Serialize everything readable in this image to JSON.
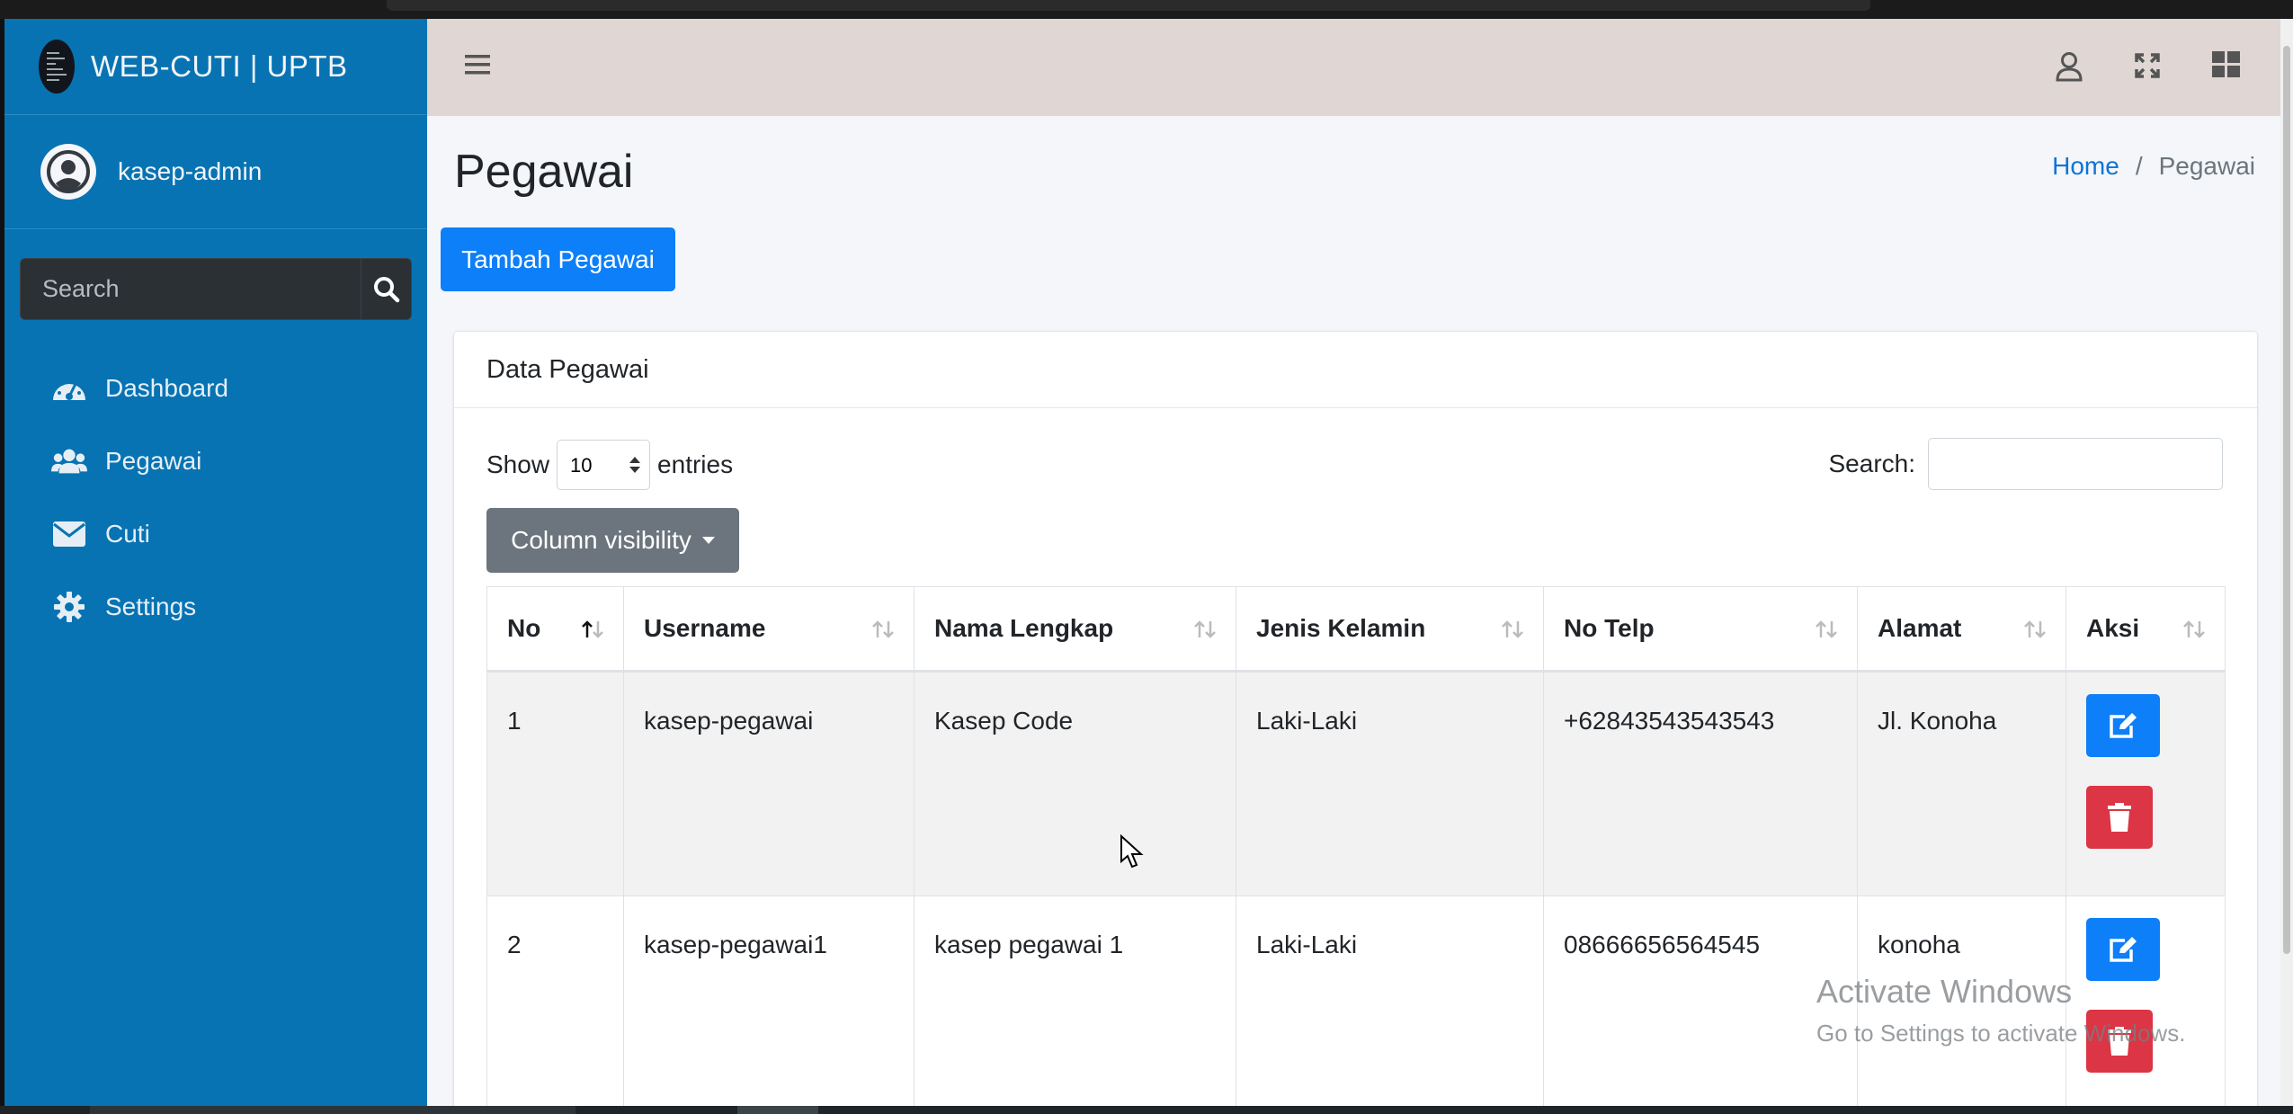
{
  "brand": {
    "title": "WEB-CUTI | UPTB"
  },
  "user": {
    "name": "kasep-admin"
  },
  "sidebar": {
    "search_placeholder": "Search",
    "items": [
      {
        "label": "Dashboard",
        "icon": "tachometer-icon"
      },
      {
        "label": "Pegawai",
        "icon": "users-icon"
      },
      {
        "label": "Cuti",
        "icon": "envelope-icon"
      },
      {
        "label": "Settings",
        "icon": "gear-icon"
      }
    ]
  },
  "page": {
    "title": "Pegawai",
    "breadcrumb": {
      "home": "Home",
      "separator": "/",
      "current": "Pegawai"
    },
    "add_button": "Tambah Pegawai"
  },
  "card": {
    "title": "Data Pegawai",
    "show_label": "Show",
    "entries_value": "10",
    "entries_label": "entries",
    "search_label": "Search:",
    "search_value": "",
    "colvis_label": "Column visibility"
  },
  "table": {
    "headers": [
      "No",
      "Username",
      "Nama Lengkap",
      "Jenis Kelamin",
      "No Telp",
      "Alamat",
      "Aksi"
    ],
    "rows": [
      {
        "no": "1",
        "username": "kasep-pegawai",
        "nama": "Kasep Code",
        "jk": "Laki-Laki",
        "telp": "+62843543543543",
        "alamat": "Jl. Konoha"
      },
      {
        "no": "2",
        "username": "kasep-pegawai1",
        "nama": "kasep pegawai 1",
        "jk": "Laki-Laki",
        "telp": "08666656564545",
        "alamat": "konoha"
      }
    ]
  },
  "watermark": {
    "line1": "Activate Windows",
    "line2": "Go to Settings to activate Windows."
  },
  "colors": {
    "sidebar": "#0773b3",
    "primary": "#0d7ff8",
    "danger": "#dc3545",
    "secondary": "#6c757d",
    "topnav": "#e0d6d4"
  }
}
